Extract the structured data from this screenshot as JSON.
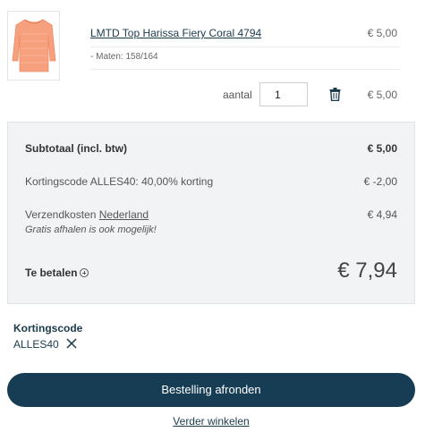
{
  "product": {
    "name": "LMTD Top Harissa Fiery Coral 4794",
    "price": "€ 5,00",
    "size": "- Maten: 158/164",
    "image_icon": "coral-top-image"
  },
  "quantity": {
    "label": "aantal",
    "value": "1",
    "line_total": "€ 5,00"
  },
  "summary": {
    "subtotal_label": "Subtotaal (incl. btw)",
    "subtotal_value": "€ 5,00",
    "discount_label": "Kortingscode ALLES40: 40,00% korting",
    "discount_value": "€ -2,00",
    "shipping_label_prefix": "Verzendkosten ",
    "shipping_country": "Nederland",
    "shipping_value": "€ 4,94",
    "shipping_note": "Gratis afhalen is ook mogelijk!",
    "total_label": "Te betalen",
    "total_value": "€ 7,94"
  },
  "discount_code": {
    "title": "Kortingscode",
    "value": "ALLES40"
  },
  "actions": {
    "checkout_label": "Bestelling afronden",
    "continue_label": "Verder winkelen"
  },
  "colors": {
    "accent": "#173d54",
    "summary_bg": "#f2f3f5",
    "product_coral": "#f7a07e"
  }
}
